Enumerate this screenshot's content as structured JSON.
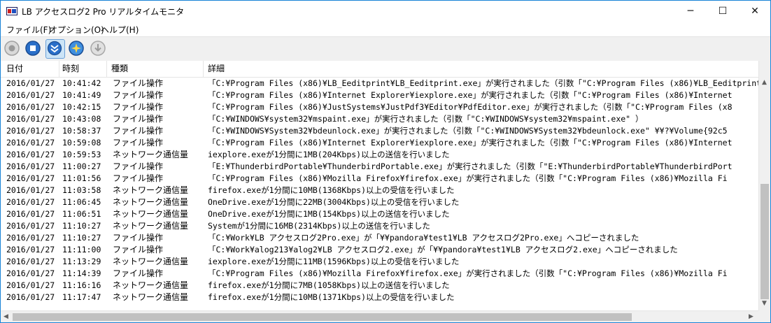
{
  "window": {
    "title": "LB アクセスログ2 Pro リアルタイムモニタ",
    "minimize": "─",
    "maximize": "☐",
    "close": "✕"
  },
  "menu": [
    {
      "label": "ファイル(F)"
    },
    {
      "label": "オプション(O)"
    },
    {
      "label": "ヘルプ(H)"
    }
  ],
  "toolbar": {
    "buttons": [
      {
        "icon": "record-icon",
        "state": "disabled"
      },
      {
        "icon": "stop-icon",
        "state": "normal"
      },
      {
        "icon": "autoscroll-down-icon",
        "state": "active"
      },
      {
        "icon": "filter-icon",
        "state": "normal"
      },
      {
        "icon": "download-icon",
        "state": "disabled"
      }
    ]
  },
  "table": {
    "columns": [
      "日付",
      "時刻",
      "種類",
      "詳細"
    ],
    "rows": [
      {
        "date": "2016/01/27",
        "time": "10:41:42",
        "type": "ファイル操作",
        "detail": "「C:¥Program Files (x86)¥LB_Eeditprint¥LB_Eeditprint.exe」が実行されました（引数「\"C:¥Program Files (x86)¥LB_Eeditprint"
      },
      {
        "date": "2016/01/27",
        "time": "10:41:49",
        "type": "ファイル操作",
        "detail": "「C:¥Program Files (x86)¥Internet Explorer¥iexplore.exe」が実行されました（引数「\"C:¥Program Files (x86)¥Internet"
      },
      {
        "date": "2016/01/27",
        "time": "10:42:15",
        "type": "ファイル操作",
        "detail": "「C:¥Program Files (x86)¥JustSystems¥JustPdf3¥Editor¥PdfEditor.exe」が実行されました（引数「\"C:¥Program Files (x8"
      },
      {
        "date": "2016/01/27",
        "time": "10:43:08",
        "type": "ファイル操作",
        "detail": "「C:¥WINDOWS¥system32¥mspaint.exe」が実行されました（引数「\"C:¥WINDOWS¥system32¥mspaint.exe\" ）"
      },
      {
        "date": "2016/01/27",
        "time": "10:58:37",
        "type": "ファイル操作",
        "detail": "「C:¥WINDOWS¥System32¥bdeunlock.exe」が実行されました（引数「\"C:¥WINDOWS¥System32¥bdeunlock.exe\" ¥¥?¥Volume{92c5"
      },
      {
        "date": "2016/01/27",
        "time": "10:59:08",
        "type": "ファイル操作",
        "detail": "「C:¥Program Files (x86)¥Internet Explorer¥iexplore.exe」が実行されました（引数「\"C:¥Program Files (x86)¥Internet"
      },
      {
        "date": "2016/01/27",
        "time": "10:59:53",
        "type": "ネットワーク通信量",
        "detail": "iexplore.exeが1分間に1MB(204Kbps)以上の送信を行いました"
      },
      {
        "date": "2016/01/27",
        "time": "11:00:27",
        "type": "ファイル操作",
        "detail": "「E:¥ThunderbirdPortable¥ThunderbirdPortable.exe」が実行されました（引数「\"E:¥ThunderbirdPortable¥ThunderbirdPort"
      },
      {
        "date": "2016/01/27",
        "time": "11:01:56",
        "type": "ファイル操作",
        "detail": "「C:¥Program Files (x86)¥Mozilla Firefox¥firefox.exe」が実行されました（引数「\"C:¥Program Files (x86)¥Mozilla Fi"
      },
      {
        "date": "2016/01/27",
        "time": "11:03:58",
        "type": "ネットワーク通信量",
        "detail": "firefox.exeが1分間に10MB(1368Kbps)以上の受信を行いました"
      },
      {
        "date": "2016/01/27",
        "time": "11:06:45",
        "type": "ネットワーク通信量",
        "detail": "OneDrive.exeが1分間に22MB(3004Kbps)以上の受信を行いました"
      },
      {
        "date": "2016/01/27",
        "time": "11:06:51",
        "type": "ネットワーク通信量",
        "detail": "OneDrive.exeが1分間に1MB(154Kbps)以上の送信を行いました"
      },
      {
        "date": "2016/01/27",
        "time": "11:10:27",
        "type": "ネットワーク通信量",
        "detail": "Systemが1分間に16MB(2314Kbps)以上の送信を行いました"
      },
      {
        "date": "2016/01/27",
        "time": "11:10:27",
        "type": "ファイル操作",
        "detail": "「C:¥Work¥LB アクセスログ2Pro.exe」が「¥¥pandora¥test1¥LB アクセスログ2Pro.exe」へコピーされました"
      },
      {
        "date": "2016/01/27",
        "time": "11:11:00",
        "type": "ファイル操作",
        "detail": "「C:¥Work¥alog213¥alog2¥LB アクセスログ2.exe」が「¥¥pandora¥test1¥LB アクセスログ2.exe」へコピーされました"
      },
      {
        "date": "2016/01/27",
        "time": "11:13:29",
        "type": "ネットワーク通信量",
        "detail": "iexplore.exeが1分間に11MB(1596Kbps)以上の受信を行いました"
      },
      {
        "date": "2016/01/27",
        "time": "11:14:39",
        "type": "ファイル操作",
        "detail": "「C:¥Program Files (x86)¥Mozilla Firefox¥firefox.exe」が実行されました（引数「\"C:¥Program Files (x86)¥Mozilla Fi"
      },
      {
        "date": "2016/01/27",
        "time": "11:16:16",
        "type": "ネットワーク通信量",
        "detail": "firefox.exeが1分間に7MB(1058Kbps)以上の送信を行いました"
      },
      {
        "date": "2016/01/27",
        "time": "11:17:47",
        "type": "ネットワーク通信量",
        "detail": "firefox.exeが1分間に10MB(1371Kbps)以上の受信を行いました"
      }
    ]
  },
  "scrollbars": {
    "up": "▲",
    "down": "▼",
    "left": "◀",
    "right": "▶"
  }
}
